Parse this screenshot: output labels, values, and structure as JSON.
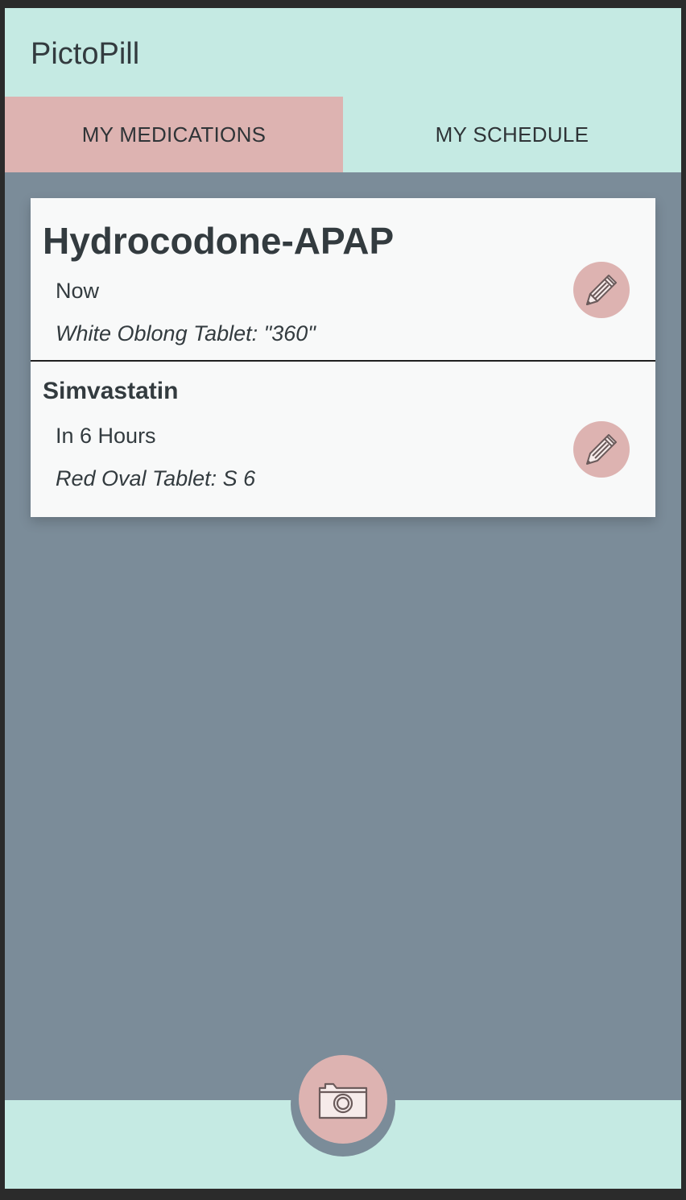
{
  "app": {
    "title": "PictoPill"
  },
  "tabs": [
    {
      "label": "MY MEDICATIONS",
      "active": true
    },
    {
      "label": "MY SCHEDULE",
      "active": false
    }
  ],
  "medications": [
    {
      "name": "Hydrocodone-APAP",
      "time": "Now",
      "description": "White Oblong Tablet: \"360\""
    },
    {
      "name": "Simvastatin",
      "time": "In 6 Hours",
      "description": "Red Oval Tablet: S 6"
    }
  ],
  "icons": {
    "edit": "pencil-icon",
    "camera": "camera-icon"
  },
  "colors": {
    "header_bg": "#c5eae3",
    "active_tab_bg": "#ddb3b1",
    "content_bg": "#7b8c99",
    "card_bg": "#f8f9f9",
    "accent": "#ddb3b1"
  }
}
